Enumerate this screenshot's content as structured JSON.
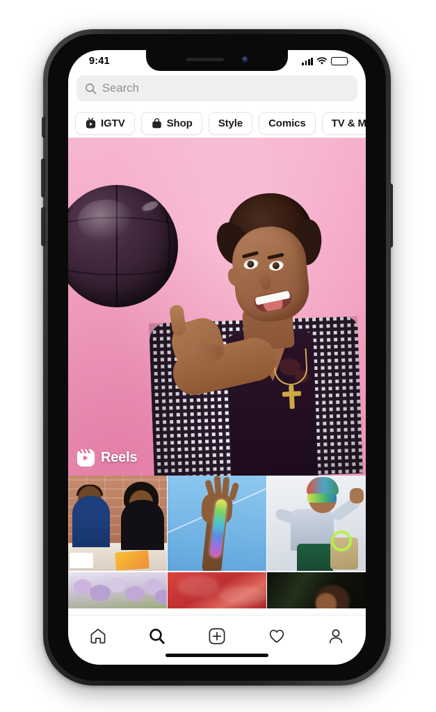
{
  "device": {
    "name": "iphone-x-mockup",
    "frame_color": "#2c2c2e"
  },
  "status_bar": {
    "time": "9:41",
    "signal_icon": "cellular-signal-icon",
    "wifi_icon": "wifi-icon",
    "battery_icon": "battery-full-icon"
  },
  "search": {
    "icon": "search-icon",
    "placeholder": "Search",
    "value": ""
  },
  "chips": [
    {
      "label": "IGTV",
      "icon": "igtv-icon"
    },
    {
      "label": "Shop",
      "icon": "shopping-bag-icon"
    },
    {
      "label": "Style",
      "icon": null
    },
    {
      "label": "Comics",
      "icon": null
    },
    {
      "label": "TV & Movies",
      "icon": null
    }
  ],
  "feed": {
    "hero": {
      "badge_label": "Reels",
      "badge_icon": "reels-icon",
      "description": "Person spinning a dark basketball on one finger, making a shaka hand sign, tongue out, wearing a houndstooth check blazer over a dark v-neck top with a gold cross necklace, against a pink studio backdrop.",
      "background_color": "#f2a0c2"
    },
    "grid": [
      {
        "position": 1,
        "description": "Two people seated at a table in front of a brick wall, one in a blue track jacket, one in black, with an orange notebook."
      },
      {
        "position": 2,
        "description": "A hand raised against a blue sky, arm covered in rainbow beaded jewelry."
      },
      {
        "position": 3,
        "description": "Person in a colorful knit beanie and mirrored sunglasses wearing a light denim jacket and green pants, holding a tan bag."
      },
      {
        "position": 4,
        "description": "Close-up of lilac and purple flowers with greenery."
      },
      {
        "position": 5,
        "description": "Close-up of draped red satin fabric."
      },
      {
        "position": 6,
        "description": "Dark foliage with a blurred person in the foreground."
      }
    ]
  },
  "tab_bar": {
    "items": [
      {
        "name": "home",
        "icon": "home-icon",
        "active": false
      },
      {
        "name": "search",
        "icon": "search-icon",
        "active": true
      },
      {
        "name": "create",
        "icon": "plus-box-icon",
        "active": false
      },
      {
        "name": "activity",
        "icon": "heart-icon",
        "active": false
      },
      {
        "name": "profile",
        "icon": "person-icon",
        "active": false
      }
    ]
  },
  "colors": {
    "search_bar_bg": "#efefef",
    "placeholder_text": "#8e8e8e",
    "chip_border": "#e4e4e4",
    "reels_badge_text": "#ffffff",
    "icon_stroke": "#262626"
  }
}
